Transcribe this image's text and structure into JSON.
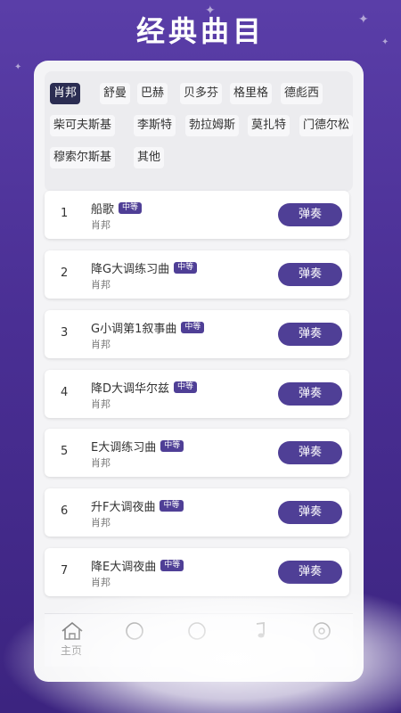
{
  "header": {
    "title": "经典曲目"
  },
  "composers": [
    {
      "label": "肖邦",
      "active": true
    },
    {
      "label": "舒曼"
    },
    {
      "label": "巴赫"
    },
    {
      "label": "贝多芬"
    },
    {
      "label": "格里格"
    },
    {
      "label": "德彪西"
    },
    {
      "label": "柴可夫斯基"
    },
    {
      "label": "李斯特"
    },
    {
      "label": "勃拉姆斯"
    },
    {
      "label": "莫扎特"
    },
    {
      "label": "门德尔松"
    },
    {
      "label": "穆索尔斯基"
    },
    {
      "label": "其他"
    }
  ],
  "songs": [
    {
      "num": "1",
      "name": "船歌",
      "level": "中等",
      "composer": "肖邦",
      "action": "弹奏"
    },
    {
      "num": "2",
      "name": "降G大调练习曲",
      "level": "中等",
      "composer": "肖邦",
      "action": "弹奏"
    },
    {
      "num": "3",
      "name": "G小调第1叙事曲",
      "level": "中等",
      "composer": "肖邦",
      "action": "弹奏"
    },
    {
      "num": "4",
      "name": "降D大调华尔兹",
      "level": "中等",
      "composer": "肖邦",
      "action": "弹奏"
    },
    {
      "num": "5",
      "name": "E大调练习曲",
      "level": "中等",
      "composer": "肖邦",
      "action": "弹奏"
    },
    {
      "num": "6",
      "name": "升F大调夜曲",
      "level": "中等",
      "composer": "肖邦",
      "action": "弹奏"
    },
    {
      "num": "7",
      "name": "降E大调夜曲",
      "level": "中等",
      "composer": "肖邦",
      "action": "弹奏"
    }
  ],
  "tabbar": {
    "home_label": "主页",
    "home_icon": "home-icon",
    "icons": [
      "circle-icon",
      "circle-icon",
      "music-note-icon",
      "record-icon"
    ]
  },
  "colors": {
    "accent": "#4f3f96",
    "active_chip": "#2b2d52"
  }
}
